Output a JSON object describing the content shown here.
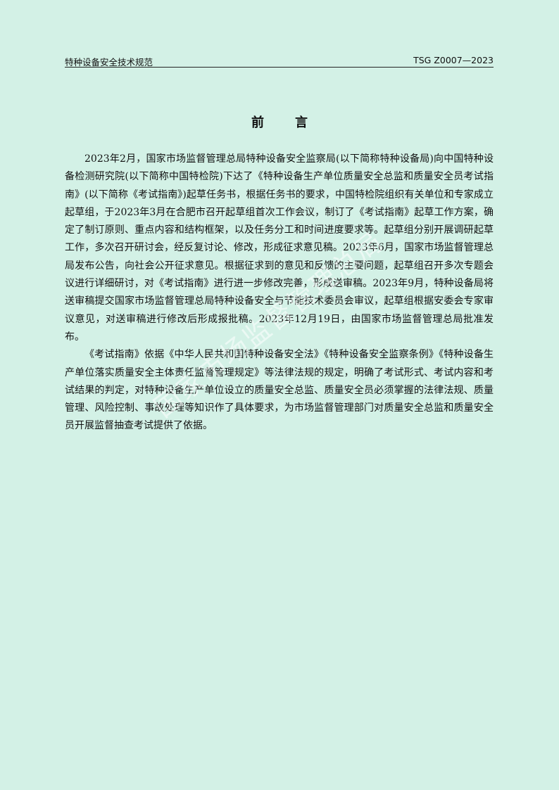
{
  "header": {
    "left": "特种设备安全技术规范",
    "right": "TSG Z0007—2023"
  },
  "title": "前言",
  "paragraphs": [
    "2023年2月，国家市场监督管理总局特种设备安全监察局(以下简称特种设备局)向中国特种设备检测研究院(以下简称中国特检院)下达了《特种设备生产单位质量安全总监和质量安全员考试指南》(以下简称《考试指南》)起草任务书，根据任务书的要求，中国特检院组织有关单位和专家成立起草组，于2023年3月在合肥市召开起草组首次工作会议，制订了《考试指南》起草工作方案，确定了制订原则、重点内容和结构框架，以及任务分工和时间进度要求等。起草组分别开展调研起草工作，多次召开研讨会，经反复讨论、修改，形成征求意见稿。2023年6月，国家市场监督管理总局发布公告，向社会公开征求意见。根据征求到的意见和反馈的主要问题，起草组召开多次专题会议进行详细研讨，对《考试指南》进行进一步修改完善，形成送审稿。2023年9月，特种设备局将送审稿提交国家市场监督管理总局特种设备安全与节能技术委员会审议，起草组根据安委会专家审议意见，对送审稿进行修改后形成报批稿。2023年12月19日，由国家市场监督管理总局批准发布。",
    "《考试指南》依据《中华人民共和国特种设备安全法》《特种设备安全监察条例》《特种设备生产单位落实质量安全主体责任监督管理规定》等法律法规的规定，明确了考试形式、考试内容和考试结果的判定，对特种设备生产单位设立的质量安全总监、质量安全员必须掌握的法律法规、质量管理、风险控制、事故处理等知识作了具体要求，为市场监督管理部门对质量安全总监和质量安全员开展监督抽查考试提供了依据。"
  ],
  "watermark": "国家市场监督管理总局"
}
